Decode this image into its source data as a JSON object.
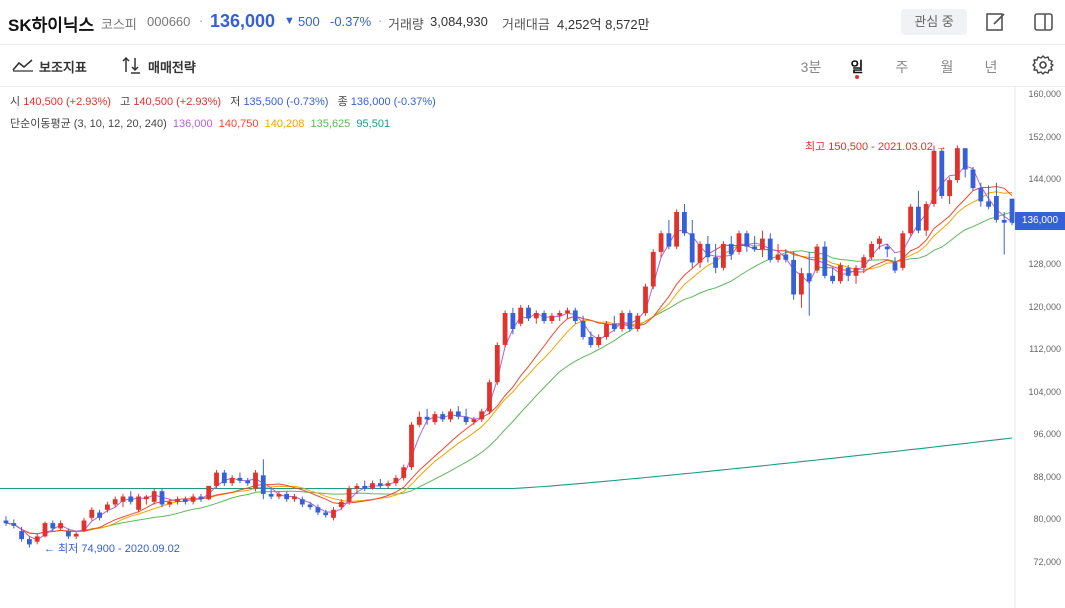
{
  "header": {
    "stock_name": "SK하이닉스",
    "market": "코스피",
    "code": "000660",
    "separator": "·",
    "price": "136,000",
    "change_arrow": "▼",
    "change": "500",
    "change_pct": "-0.37%",
    "volume_label": "거래량",
    "volume": "3,084,930",
    "amount_label": "거래대금",
    "amount": "4,252억 8,572만",
    "favorite_label": "관심 중"
  },
  "toolbar": {
    "indicator_label": "보조지표",
    "strategy_label": "매매전략",
    "periods": [
      "3분",
      "일",
      "주",
      "월",
      "년"
    ],
    "active_period": "일"
  },
  "ohlc": {
    "open_label": "시",
    "open": "140,500 (+2.93%)",
    "high_label": "고",
    "high": "140,500 (+2.93%)",
    "low_label": "저",
    "low": "135,500 (-0.73%)",
    "close_label": "종",
    "close": "136,000 (-0.37%)"
  },
  "ma": {
    "label": "단순이동평균 (3, 10, 12, 20, 240)",
    "values": [
      "136,000",
      "140,750",
      "140,208",
      "135,625",
      "95,501"
    ]
  },
  "annotations": {
    "high": "최고 150,500 - 2021.03.02 →",
    "low": "← 최저 74,900 - 2020.09.02"
  },
  "axis": {
    "labels": [
      "160,000",
      "152,000",
      "144,000",
      "136,000",
      "128,000",
      "120,000",
      "112,000",
      "104,000",
      "96,000",
      "88,000",
      "80,000",
      "72,000"
    ],
    "current_price_tag": "136,000"
  },
  "colors": {
    "up": "#e0332b",
    "down": "#3560d8",
    "ma3": "#b063d6",
    "ma10": "#f0472f",
    "ma12": "#f2a400",
    "ma20": "#5cb858",
    "ma240": "#1e9a86"
  },
  "chart_data": {
    "type": "candlestick",
    "ylim": [
      70000,
      162000
    ],
    "candles": [
      [
        80000,
        80800,
        79000,
        79500
      ],
      [
        79500,
        80200,
        78500,
        79000
      ],
      [
        78000,
        78800,
        76000,
        76500
      ],
      [
        76500,
        77000,
        74900,
        75500
      ],
      [
        76000,
        77500,
        75500,
        77000
      ],
      [
        77000,
        79800,
        76800,
        79500
      ],
      [
        79500,
        80000,
        78000,
        78500
      ],
      [
        78500,
        80000,
        78000,
        79500
      ],
      [
        78000,
        78500,
        76500,
        77000
      ],
      [
        77000,
        77800,
        76500,
        77500
      ],
      [
        78000,
        80500,
        77800,
        80000
      ],
      [
        80500,
        82500,
        80000,
        82000
      ],
      [
        81500,
        82000,
        80000,
        80500
      ],
      [
        82000,
        83500,
        81500,
        83000
      ],
      [
        83000,
        84500,
        82500,
        84000
      ],
      [
        83500,
        85000,
        82500,
        84500
      ],
      [
        84500,
        85500,
        83000,
        83500
      ],
      [
        82000,
        85000,
        81500,
        84500
      ],
      [
        84000,
        84800,
        83000,
        84500
      ],
      [
        83500,
        86000,
        83000,
        85500
      ],
      [
        85500,
        86000,
        82500,
        83000
      ],
      [
        83000,
        84000,
        82500,
        83500
      ],
      [
        83500,
        84500,
        83000,
        84000
      ],
      [
        84000,
        84500,
        83000,
        83500
      ],
      [
        83500,
        85000,
        83000,
        84500
      ],
      [
        84500,
        85000,
        83500,
        84000
      ],
      [
        84000,
        86500,
        83800,
        86500
      ],
      [
        86500,
        89500,
        86000,
        89000
      ],
      [
        89000,
        89500,
        86500,
        87000
      ],
      [
        87000,
        88500,
        86500,
        88000
      ],
      [
        88000,
        89000,
        87000,
        87500
      ],
      [
        87500,
        88000,
        86500,
        87000
      ],
      [
        86000,
        89500,
        85500,
        89000
      ],
      [
        88500,
        91500,
        84000,
        85000
      ],
      [
        85000,
        86000,
        84000,
        84500
      ],
      [
        84500,
        85500,
        84000,
        85000
      ],
      [
        85000,
        85500,
        83500,
        84000
      ],
      [
        84000,
        85000,
        83500,
        84500
      ],
      [
        84000,
        84500,
        82500,
        83000
      ],
      [
        83000,
        83500,
        82000,
        82500
      ],
      [
        82500,
        83000,
        81000,
        81500
      ],
      [
        81500,
        82000,
        80500,
        81000
      ],
      [
        80500,
        82500,
        80000,
        82000
      ],
      [
        82500,
        84000,
        82000,
        83500
      ],
      [
        83500,
        86500,
        83000,
        86000
      ],
      [
        86000,
        87000,
        85000,
        86500
      ],
      [
        86500,
        87500,
        85500,
        86000
      ],
      [
        86000,
        87500,
        85800,
        87000
      ],
      [
        87000,
        87800,
        86000,
        86500
      ],
      [
        86500,
        87500,
        86000,
        87000
      ],
      [
        87000,
        88500,
        86500,
        88000
      ],
      [
        88000,
        90500,
        87500,
        90000
      ],
      [
        90000,
        98500,
        89500,
        98000
      ],
      [
        98000,
        100500,
        97500,
        99500
      ],
      [
        99500,
        101000,
        98000,
        99000
      ],
      [
        98500,
        100500,
        98000,
        100000
      ],
      [
        100000,
        100500,
        98500,
        99000
      ],
      [
        99000,
        101000,
        98500,
        100500
      ],
      [
        100500,
        101500,
        99000,
        99500
      ],
      [
        99500,
        101000,
        98000,
        98500
      ],
      [
        98500,
        99500,
        98000,
        99000
      ],
      [
        99000,
        101000,
        98500,
        100500
      ],
      [
        100500,
        106500,
        100000,
        106000
      ],
      [
        106000,
        113500,
        105500,
        113000
      ],
      [
        113000,
        119500,
        112500,
        119000
      ],
      [
        119000,
        120000,
        115000,
        116000
      ],
      [
        117000,
        120500,
        116500,
        120000
      ],
      [
        120000,
        120500,
        117500,
        118000
      ],
      [
        118000,
        119500,
        117000,
        119000
      ],
      [
        119000,
        119500,
        117000,
        117500
      ],
      [
        117500,
        119000,
        117000,
        118500
      ],
      [
        118500,
        119500,
        117500,
        119000
      ],
      [
        119000,
        120000,
        118000,
        119500
      ],
      [
        119500,
        120000,
        117000,
        117500
      ],
      [
        117500,
        118500,
        114000,
        114500
      ],
      [
        114500,
        115500,
        112500,
        113000
      ],
      [
        113000,
        115000,
        112500,
        114500
      ],
      [
        114500,
        117500,
        114000,
        117000
      ],
      [
        117000,
        118500,
        115500,
        116000
      ],
      [
        116000,
        119500,
        115500,
        119000
      ],
      [
        119000,
        119500,
        115500,
        116000
      ],
      [
        116000,
        119000,
        115500,
        118500
      ],
      [
        119000,
        124500,
        118500,
        124000
      ],
      [
        124000,
        131000,
        123500,
        130500
      ],
      [
        130500,
        134500,
        129500,
        134000
      ],
      [
        134000,
        136500,
        131000,
        131500
      ],
      [
        131500,
        138500,
        131000,
        138000
      ],
      [
        138000,
        139500,
        133500,
        134000
      ],
      [
        134000,
        136500,
        127500,
        128500
      ],
      [
        128500,
        132500,
        127500,
        132000
      ],
      [
        132000,
        133500,
        128500,
        129500
      ],
      [
        129500,
        132000,
        126500,
        127500
      ],
      [
        127500,
        132500,
        127000,
        132000
      ],
      [
        132000,
        133500,
        129000,
        130000
      ],
      [
        130500,
        134500,
        130000,
        134000
      ],
      [
        134000,
        134500,
        130500,
        131500
      ],
      [
        131500,
        133500,
        130500,
        131000
      ],
      [
        131000,
        134500,
        129500,
        133000
      ],
      [
        133000,
        134000,
        128500,
        129000
      ],
      [
        129000,
        132000,
        128500,
        130000
      ],
      [
        130000,
        131000,
        128500,
        129000
      ],
      [
        129000,
        130500,
        121500,
        122500
      ],
      [
        122500,
        127500,
        120000,
        126500
      ],
      [
        126500,
        130500,
        118500,
        125000
      ],
      [
        127000,
        132000,
        126500,
        131500
      ],
      [
        131500,
        132500,
        125500,
        126000
      ],
      [
        126000,
        127500,
        124500,
        125000
      ],
      [
        125000,
        128500,
        124500,
        128000
      ],
      [
        127500,
        128000,
        125000,
        126000
      ],
      [
        126000,
        128000,
        124500,
        127500
      ],
      [
        127500,
        130000,
        126500,
        129500
      ],
      [
        129500,
        132500,
        129000,
        132000
      ],
      [
        132000,
        133500,
        131000,
        133000
      ],
      [
        131500,
        132000,
        129500,
        131000
      ],
      [
        128500,
        129500,
        126500,
        127000
      ],
      [
        127500,
        134500,
        127000,
        134000
      ],
      [
        134000,
        139500,
        133500,
        139000
      ],
      [
        139000,
        142000,
        134000,
        134500
      ],
      [
        134500,
        140000,
        133500,
        139500
      ],
      [
        139500,
        150500,
        139000,
        149500
      ],
      [
        149500,
        150000,
        140500,
        141000
      ],
      [
        141000,
        144500,
        139500,
        144000
      ],
      [
        144000,
        150500,
        143500,
        150000
      ],
      [
        150000,
        150000,
        144500,
        146000
      ],
      [
        146000,
        146500,
        142000,
        142500
      ],
      [
        142500,
        143500,
        139000,
        140000
      ],
      [
        140000,
        143000,
        138500,
        139000
      ],
      [
        141000,
        143500,
        136000,
        136500
      ],
      [
        136500,
        138000,
        130000,
        136000
      ],
      [
        140500,
        140500,
        135500,
        136000
      ]
    ],
    "ma_series": [
      {
        "name": "3",
        "color_key": "ma3"
      },
      {
        "name": "10",
        "color_key": "ma10"
      },
      {
        "name": "12",
        "color_key": "ma12"
      },
      {
        "name": "20",
        "color_key": "ma20"
      },
      {
        "name": "240",
        "color_key": "ma240"
      }
    ],
    "ma240_start": 86000,
    "ma240_end": 95501,
    "ma240_flat_until": 65,
    "high": 150500,
    "low": 74900
  }
}
